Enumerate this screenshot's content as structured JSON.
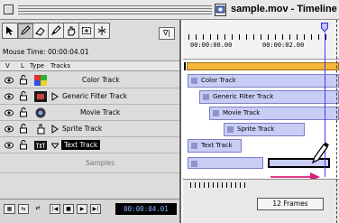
{
  "window": {
    "title": "sample.mov - Timeline E"
  },
  "toolbar": {
    "snap_label": "∇|"
  },
  "mouse_time": "Mouse Time: 00:00:04.01",
  "columns": {
    "visible": "V",
    "lock": "L",
    "type": "Type",
    "tracks": "Tracks"
  },
  "tracks": [
    {
      "name": "Color Track",
      "expandable": false
    },
    {
      "name": "Generic Filter Track",
      "expandable": true
    },
    {
      "name": "Movie Track",
      "expandable": false
    },
    {
      "name": "Sprite Track",
      "expandable": true
    },
    {
      "name": "Text Track",
      "expandable": true,
      "expanded": true,
      "selected": true
    },
    {
      "name": "Samples",
      "subrow": true
    }
  ],
  "bottom": {
    "timecode": "00:00:04.01"
  },
  "ruler": {
    "tc_start": "00:00:00.00",
    "tc_second": "00:00:02.00"
  },
  "timeline_labels": [
    "Color Track",
    "Generic Filter Track",
    "Movie Track",
    "Sprite Track",
    "Text Track"
  ],
  "zoom": {
    "label": "12 Frames"
  },
  "colors": {
    "track_fill": "#c9cdf5",
    "orange_bar": "#f5b63a",
    "playhead": "#3a3aff",
    "arrow": "#d8207a"
  }
}
